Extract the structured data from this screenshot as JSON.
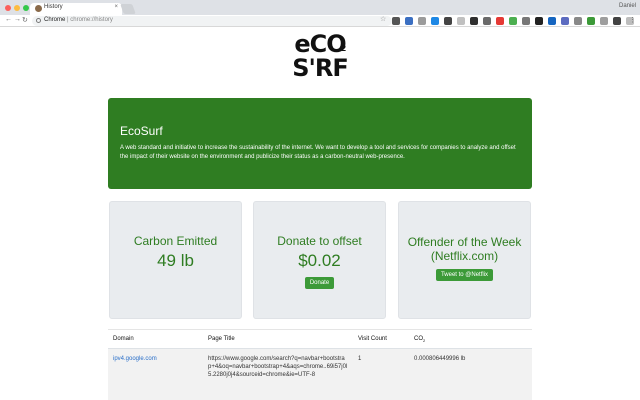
{
  "browser": {
    "tab_title": "History",
    "tab_close": "×",
    "profile_name": "Daniel",
    "url_host": "Chrome",
    "url_sep": " | ",
    "url_path": "chrome://history",
    "star_icon": "☆",
    "menu_icon": "⋮"
  },
  "logo": {
    "line1": "eCO",
    "line1_sub": "2",
    "line2": "S'RF"
  },
  "banner": {
    "title": "EcoSurf",
    "description": "A web standard and initiative to increase the sustainability of the internet. We want to develop a tool and services for companies to analyze and offset the impact of their website on the environment and publicize their status as a carbon-neutral web-presence."
  },
  "cards": {
    "carbon": {
      "title": "Carbon Emitted",
      "value": "49 lb"
    },
    "donate": {
      "title": "Donate to offset",
      "value": "$0.02",
      "button": "Donate"
    },
    "offender": {
      "title": "Offender of the Week (Netflix.com)",
      "button": "Tweet to @Netflix"
    }
  },
  "table": {
    "headers": {
      "domain": "Domain",
      "page_title": "Page Title",
      "visit_count": "Visit Count",
      "co2": "CO",
      "co2_sub": "2"
    },
    "rows": [
      {
        "domain": "ipv4.google.com",
        "page_title": "https://www.google.com/search?q=navbar+bootstrap+4&oq=navbar+bootstrap+4&aqs=chrome..69i57j0l5.2280j0j4&sourceid=chrome&ie=UTF-8",
        "visit_count": "1",
        "co2": "0.000806449996 lb"
      }
    ]
  },
  "colors": {
    "brand_green": "#2f7d22",
    "button_green": "#3c9a38",
    "link_blue": "#2a6fc9"
  }
}
